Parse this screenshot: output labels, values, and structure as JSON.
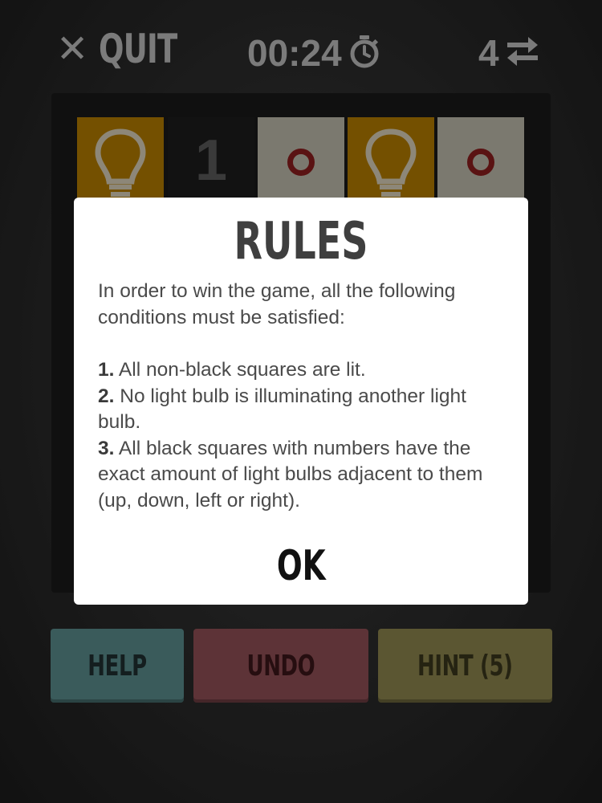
{
  "header": {
    "quit_icon": "close-icon",
    "quit_label": "QUIT",
    "timer": "00:24",
    "timer_icon": "stopwatch-icon",
    "moves": "4",
    "moves_icon": "swap-arrows-icon"
  },
  "board": {
    "row_1": [
      {
        "kind": "bulb",
        "icon": "lightbulb-icon"
      },
      {
        "kind": "black",
        "number": "1"
      },
      {
        "kind": "lit",
        "marker": "circle"
      },
      {
        "kind": "bulb",
        "icon": "lightbulb-icon"
      },
      {
        "kind": "lit",
        "marker": "circle"
      }
    ]
  },
  "buttons": {
    "help": "HELP",
    "undo": "UNDO",
    "hint": "HINT (5)"
  },
  "modal": {
    "title": "RULES",
    "intro": "In order to win the game, all the following conditions must be satisfied:",
    "rules": [
      {
        "num": "1.",
        "text": "All non-black squares are lit."
      },
      {
        "num": "2.",
        "text": "No light bulb is illuminating another light bulb."
      },
      {
        "num": "3.",
        "text": "All black squares with numbers have the exact amount of light bulbs adjacent to them (up, down, left or right)."
      }
    ],
    "ok_label": "OK"
  },
  "colors": {
    "bulb": "#b27b00",
    "lit": "#bdbbab",
    "marker": "#8a1e1e",
    "help": "#5a8c8c",
    "undo": "#8f4f55",
    "hint": "#8c844d"
  }
}
